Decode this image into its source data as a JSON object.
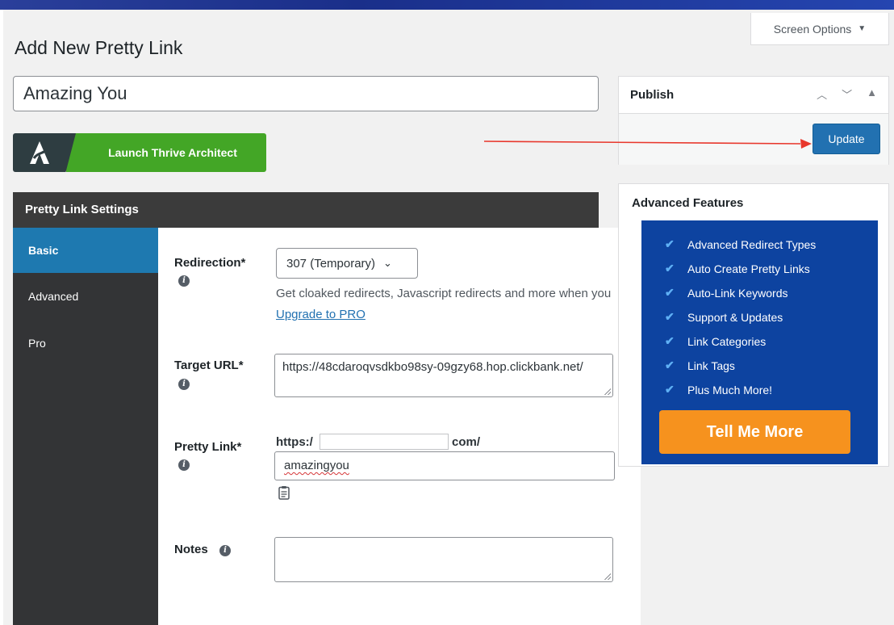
{
  "page": {
    "title": "Add New Pretty Link",
    "screen_options": "Screen Options"
  },
  "title_input": {
    "value": "Amazing You"
  },
  "thrive": {
    "label": "Launch Thrive Architect",
    "accent": "#43a626"
  },
  "settings": {
    "header": "Pretty Link Settings",
    "tabs": [
      {
        "label": "Basic",
        "active": true
      },
      {
        "label": "Advanced",
        "active": false
      },
      {
        "label": "Pro",
        "active": false
      }
    ],
    "redirection": {
      "label": "Redirection*",
      "selected": "307 (Temporary)",
      "help_text": "Get cloaked redirects, Javascript redirects and more when you",
      "help_link": "Upgrade to PRO"
    },
    "target_url": {
      "label": "Target URL*",
      "value": "https://48cdaroqvsdkbo98sy-09gzy68.hop.clickbank.net/"
    },
    "pretty_link": {
      "label": "Pretty Link*",
      "prefix": "https:/",
      "suffix": "com/",
      "slug": "amazingyou"
    },
    "notes": {
      "label": "Notes",
      "value": ""
    }
  },
  "publish": {
    "title": "Publish",
    "update_label": "Update",
    "accent": "#2271b1"
  },
  "advanced_features": {
    "title": "Advanced Features",
    "items": [
      "Advanced Redirect Types",
      "Auto Create Pretty Links",
      "Auto-Link Keywords",
      "Support & Updates",
      "Link Categories",
      "Link Tags",
      "Plus Much More!"
    ],
    "cta": "Tell Me More",
    "panel_color": "#0d43a0",
    "cta_color": "#f6921e"
  }
}
